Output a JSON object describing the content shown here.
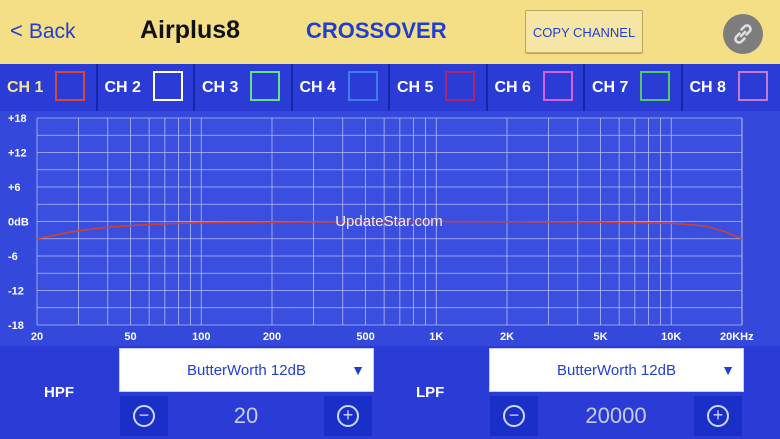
{
  "header": {
    "back_label": "Back",
    "app_title": "Airplus8",
    "screen_title": "CROSSOVER",
    "copy_label": "COPY CHANNEL",
    "link_icon": "link-icon"
  },
  "channels": [
    {
      "label": "CH 1",
      "color": "#d9463a",
      "active": true
    },
    {
      "label": "CH 2",
      "color": "#ffffff",
      "active": false
    },
    {
      "label": "CH 3",
      "color": "#64e08a",
      "active": false
    },
    {
      "label": "CH 4",
      "color": "#3a7ee8",
      "active": false
    },
    {
      "label": "CH 5",
      "color": "#a8276e",
      "active": false
    },
    {
      "label": "CH 6",
      "color": "#d561e0",
      "active": false
    },
    {
      "label": "CH 7",
      "color": "#52c86a",
      "active": false
    },
    {
      "label": "CH 8",
      "color": "#c67ad8",
      "active": false
    }
  ],
  "graph": {
    "y_ticks": [
      "+18",
      "+12",
      "+6",
      "0dB",
      "-6",
      "-12",
      "-18"
    ],
    "x_ticks": [
      "20",
      "50",
      "100",
      "200",
      "500",
      "1K",
      "2K",
      "5K",
      "10K",
      "20KHz"
    ],
    "watermark": "UpdateStar.com",
    "curve_color": "#d0432f"
  },
  "chart_data": {
    "type": "line",
    "series": [
      {
        "x": [
          20,
          25,
          30,
          40,
          60,
          100,
          200,
          1000,
          5000,
          10000,
          14000,
          17000,
          20000
        ],
        "y": [
          -3.0,
          -2.2,
          -1.6,
          -1.0,
          -0.5,
          -0.2,
          -0.1,
          0,
          -0.1,
          -0.3,
          -0.8,
          -1.8,
          -3.0
        ]
      }
    ],
    "xlim": [
      20,
      20000
    ],
    "x_scale": "log",
    "ylim": [
      -18,
      18
    ],
    "grid": true
  },
  "hpf": {
    "label": "HPF",
    "filter_type": "ButterWorth 12dB",
    "value": "20"
  },
  "lpf": {
    "label": "LPF",
    "filter_type": "ButterWorth 12dB",
    "value": "20000"
  }
}
